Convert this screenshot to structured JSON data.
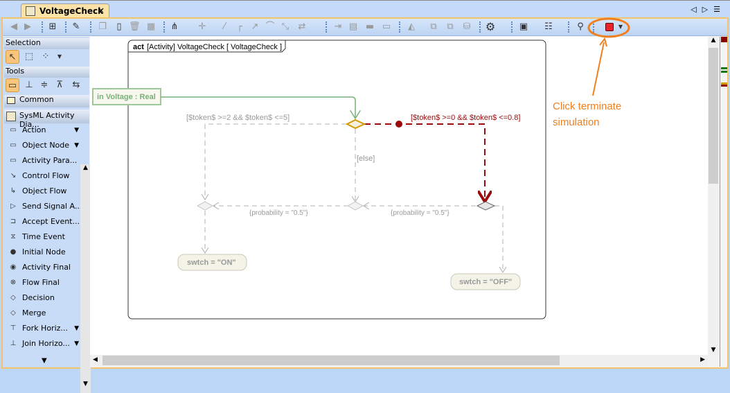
{
  "tab": {
    "title": "VoltageCheck",
    "close": "×"
  },
  "nav": {
    "prev": "◁",
    "next": "▷",
    "menu": "☰"
  },
  "palette": {
    "selection_label": "Selection",
    "tools_label": "Tools",
    "common_label": "Common",
    "group_label": "SysML Activity Dia...",
    "items": [
      {
        "label": "Action",
        "icon": "▭",
        "dropdown": true
      },
      {
        "label": "Object Node",
        "icon": "▭",
        "dropdown": true
      },
      {
        "label": "Activity Para...",
        "icon": "▭"
      },
      {
        "label": "Control Flow",
        "icon": "↘"
      },
      {
        "label": "Object Flow",
        "icon": "↳"
      },
      {
        "label": "Send Signal A...",
        "icon": "▷"
      },
      {
        "label": "Accept Event...",
        "icon": "⊐"
      },
      {
        "label": "Time Event",
        "icon": "⧖"
      },
      {
        "label": "Initial Node",
        "icon": "●"
      },
      {
        "label": "Activity Final",
        "icon": "◉"
      },
      {
        "label": "Flow Final",
        "icon": "⊗"
      },
      {
        "label": "Decision",
        "icon": "◇"
      },
      {
        "label": "Merge",
        "icon": "◇"
      },
      {
        "label": "Fork Horiz...",
        "icon": "⊤",
        "dropdown": true
      },
      {
        "label": "Join Horizo...",
        "icon": "⊥",
        "dropdown": true
      }
    ]
  },
  "diagram": {
    "frame_keyword": "act",
    "frame_title": "[Activity] VoltageCheck [ VoltageCheck ]",
    "parameter": "in Voltage : Real",
    "guard_left": "[$token$ >=2 && $token$ <=5]",
    "guard_right": "[$token$ >=0 && $token$ <=0.8]",
    "guard_else": "[else]",
    "prob_left": "{probability = \"0.5\"}",
    "prob_right": "{probability = \"0.5\"}",
    "action_on": "swtch = \"ON\"",
    "action_off": "swtch = \"OFF\""
  },
  "annotation": {
    "text_line1": "Click terminate",
    "text_line2": "simulation",
    "color": "#f07f1e"
  },
  "colors": {
    "active_flow": "#9b0a0a",
    "inactive": "#b0b0b0",
    "parameter": "#7ab07a",
    "decision_active": "#d49a00"
  }
}
